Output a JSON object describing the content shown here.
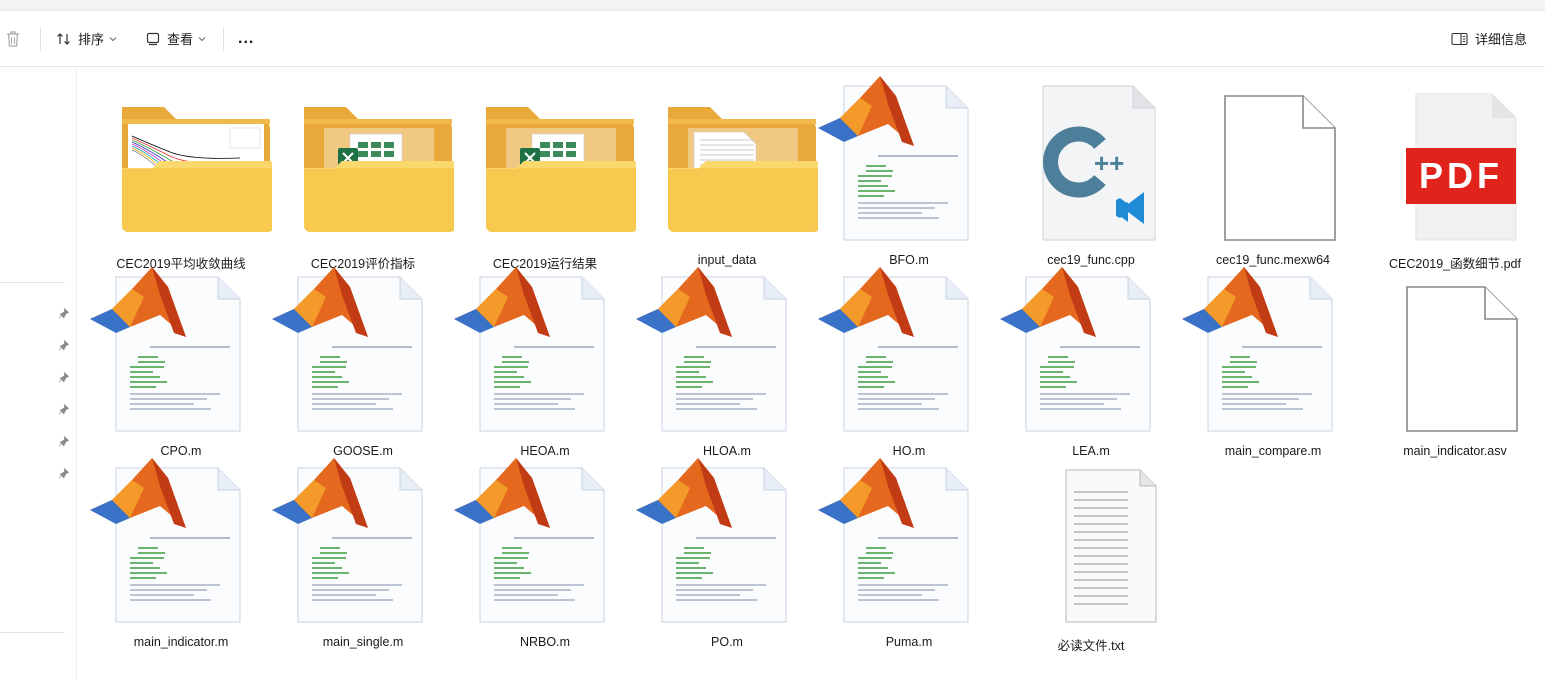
{
  "toolbar": {
    "sort_label": "排序",
    "view_label": "查看",
    "more_label": "...",
    "details_label": "详细信息"
  },
  "files": [
    {
      "name": "CEC2019平均收敛曲线",
      "type": "folder-chart"
    },
    {
      "name": "CEC2019评价指标",
      "type": "folder-excel"
    },
    {
      "name": "CEC2019运行结果",
      "type": "folder-excel"
    },
    {
      "name": "input_data",
      "type": "folder-doc"
    },
    {
      "name": "BFO.m",
      "type": "matlab"
    },
    {
      "name": "cec19_func.cpp",
      "type": "cpp"
    },
    {
      "name": "cec19_func.mexw64",
      "type": "blank"
    },
    {
      "name": "CEC2019_函数细节.pdf",
      "type": "pdf"
    },
    {
      "name": "CPO.m",
      "type": "matlab"
    },
    {
      "name": "GOOSE.m",
      "type": "matlab"
    },
    {
      "name": "HEOA.m",
      "type": "matlab"
    },
    {
      "name": "HLOA.m",
      "type": "matlab"
    },
    {
      "name": "HO.m",
      "type": "matlab"
    },
    {
      "name": "LEA.m",
      "type": "matlab"
    },
    {
      "name": "main_compare.m",
      "type": "matlab"
    },
    {
      "name": "main_indicator.asv",
      "type": "blank"
    },
    {
      "name": "main_indicator.m",
      "type": "matlab"
    },
    {
      "name": "main_single.m",
      "type": "matlab"
    },
    {
      "name": "NRBO.m",
      "type": "matlab"
    },
    {
      "name": "PO.m",
      "type": "matlab"
    },
    {
      "name": "Puma.m",
      "type": "matlab"
    },
    {
      "name": "必读文件.txt",
      "type": "txt"
    }
  ],
  "icons": {
    "pdf_badge": "PDF",
    "cpp_badge": "C++"
  },
  "colors": {
    "folder": "#f7c94f",
    "folder_back": "#e9a83a",
    "pdf_red": "#e0231b",
    "cpp_blue": "#4d7e9a",
    "vscode_blue": "#1f8ad6",
    "excel_green": "#1e7145"
  }
}
